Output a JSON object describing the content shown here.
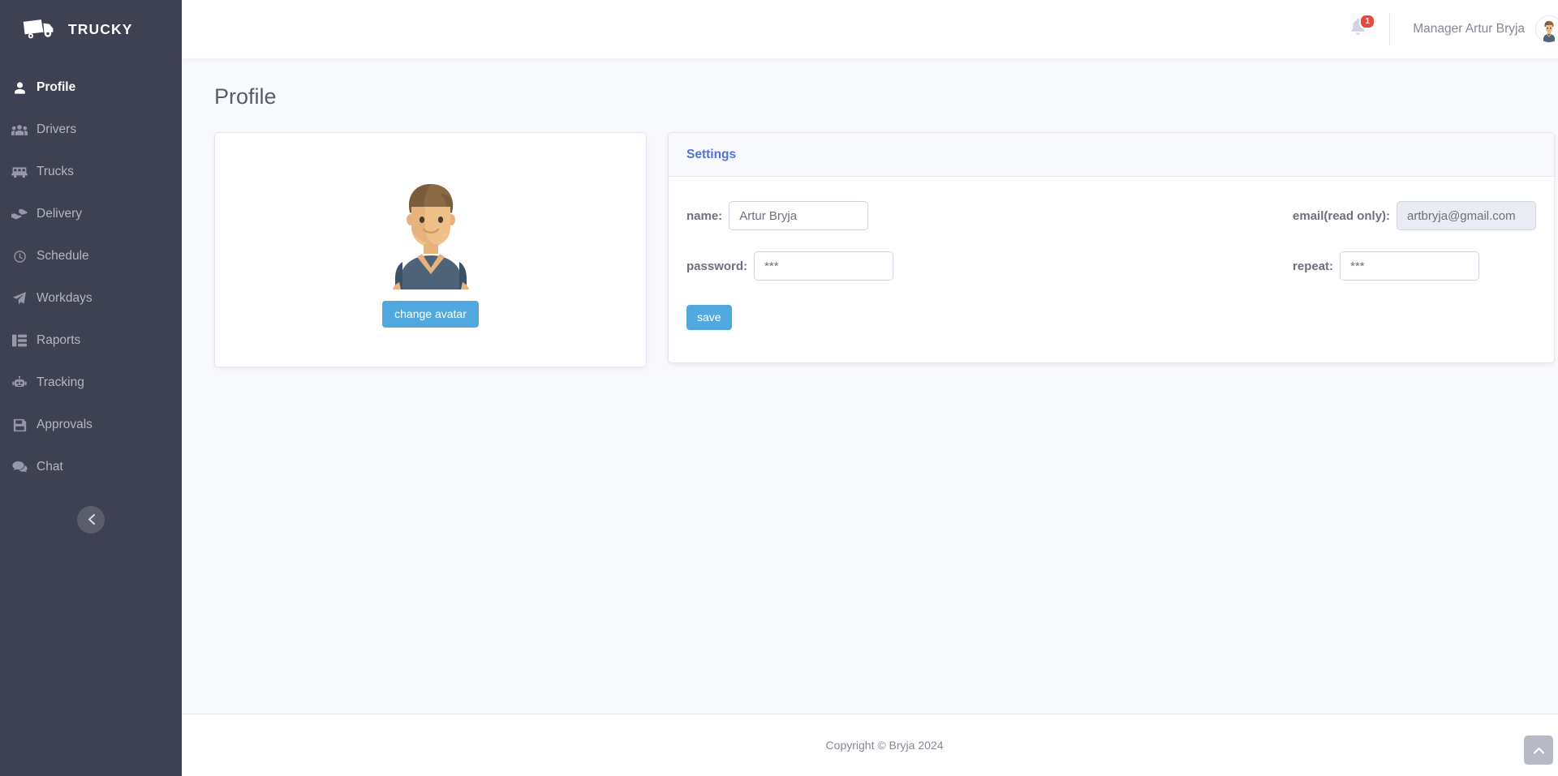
{
  "brand": {
    "name": "TRUCKY",
    "logo_icon": "truck-icon"
  },
  "sidebar": {
    "collapse_icon": "chevron-left-icon",
    "items": [
      {
        "label": "Profile",
        "icon": "user-icon",
        "active": true
      },
      {
        "label": "Drivers",
        "icon": "users-icon",
        "active": false
      },
      {
        "label": "Trucks",
        "icon": "truck-side-icon",
        "active": false
      },
      {
        "label": "Delivery",
        "icon": "hand-holding-icon",
        "active": false
      },
      {
        "label": "Schedule",
        "icon": "clock-icon",
        "active": false
      },
      {
        "label": "Workdays",
        "icon": "paper-plane-icon",
        "active": false
      },
      {
        "label": "Raports",
        "icon": "columns-icon",
        "active": false
      },
      {
        "label": "Tracking",
        "icon": "robot-icon",
        "active": false
      },
      {
        "label": "Approvals",
        "icon": "save-icon",
        "active": false
      },
      {
        "label": "Chat",
        "icon": "comments-icon",
        "active": false
      }
    ]
  },
  "topbar": {
    "bell_icon": "bell-icon",
    "notification_count": "1",
    "user_name": "Manager Artur Bryja",
    "avatar_icon": "avatar-icon"
  },
  "page": {
    "title": "Profile"
  },
  "avatar_card": {
    "avatar_icon": "avatar-illustration",
    "change_avatar_label": "change avatar"
  },
  "settings": {
    "title": "Settings",
    "fields": {
      "name_label": "name:",
      "name_value": "Artur Bryja",
      "email_label": "email(read only):",
      "email_value": "artbryja@gmail.com",
      "password_label": "password:",
      "password_value": "***",
      "repeat_label": "repeat:",
      "repeat_value": "***"
    },
    "save_label": "save"
  },
  "footer": {
    "copyright": "Copyright © Bryja 2024",
    "scroll_top_icon": "chevron-up-icon"
  },
  "colors": {
    "sidebar_bg": "#3e4152",
    "accent_blue": "#4e73df",
    "button_blue": "#4fa9de",
    "badge_red": "#e74a3b",
    "content_bg": "#f8f9fc",
    "text_muted": "#858796"
  }
}
